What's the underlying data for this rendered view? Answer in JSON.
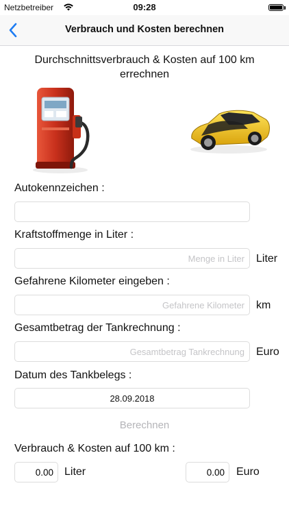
{
  "status": {
    "carrier": "Netzbetreiber",
    "time": "09:28"
  },
  "nav": {
    "title": "Verbrauch und Kosten berechnen"
  },
  "headline": "Durchschnittsverbrauch & Kosten auf 100 km errechnen",
  "form": {
    "plate_label": "Autokennzeichen :",
    "plate_value": "",
    "fuel_label": "Kraftstoffmenge in Liter :",
    "fuel_placeholder": "Menge in Liter",
    "fuel_unit": "Liter",
    "km_label": "Gefahrene Kilometer eingeben :",
    "km_placeholder": "Gefahrene Kilometer",
    "km_unit": "km",
    "total_label": "Gesamtbetrag der Tankrechnung :",
    "total_placeholder": "Gesamtbetrag Tankrechnung",
    "total_unit": "Euro",
    "date_label": "Datum des Tankbelegs :",
    "date_value": "28.09.2018"
  },
  "calculate_label": "Berechnen",
  "result": {
    "label": "Verbrauch & Kosten auf 100 km :",
    "liters_value": "0.00",
    "liters_unit": "Liter",
    "euro_value": "0.00",
    "euro_unit": "Euro"
  },
  "colors": {
    "accent": "#1e7cf2",
    "disabled": "#b4b4b8",
    "pump": "#d13a22",
    "car": "#f2c21a"
  },
  "icons": {
    "back": "chevron-left-icon",
    "pump": "fuel-pump-icon",
    "car": "sports-car-icon"
  }
}
